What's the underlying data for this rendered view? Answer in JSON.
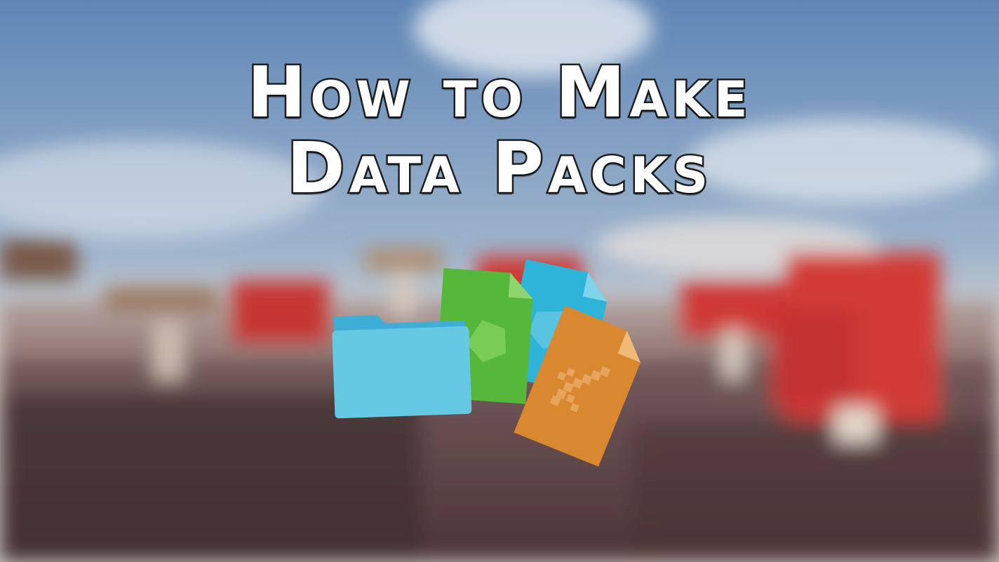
{
  "title": {
    "line1": "How to Make",
    "line2": "Data Packs"
  },
  "icons": {
    "items": [
      "folder-icon",
      "green-file-icon",
      "blue-file-icon",
      "orange-file-sword-icon"
    ],
    "colors": {
      "folder": "#66c9e3",
      "folder_tab": "#3eaed6",
      "green_file": "#56b83a",
      "blue_file": "#2eb4d9",
      "orange_file": "#d9882f"
    }
  },
  "background": {
    "sky": "#6f93bd",
    "ground": "#5a4244",
    "mushroom_red": "#d23a35"
  }
}
